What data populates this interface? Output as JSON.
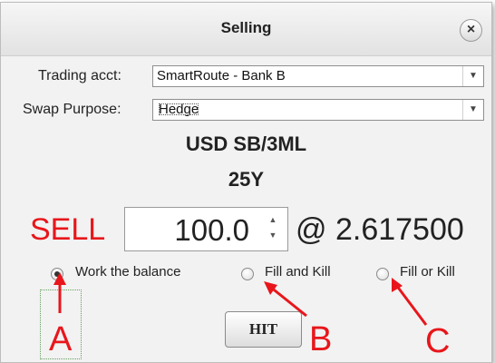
{
  "dialog": {
    "title": "Selling",
    "close_icon": "×"
  },
  "form": {
    "trading_acct_label": "Trading acct:",
    "trading_acct_value": "SmartRoute - Bank B",
    "swap_purpose_label": "Swap Purpose:",
    "swap_purpose_value": "Hedge",
    "dropdown_arrow": "▼"
  },
  "instrument": {
    "name": "USD SB/3ML",
    "tenor": "25Y"
  },
  "order": {
    "side": "SELL",
    "quantity": "100.0",
    "price": "@ 2.617500",
    "spin_up": "▲",
    "spin_down": "▼"
  },
  "options": [
    {
      "label": "Work the balance",
      "selected": true
    },
    {
      "label": "Fill and Kill",
      "selected": false
    },
    {
      "label": "Fill or Kill",
      "selected": false
    }
  ],
  "action": {
    "hit_label": "HIT"
  },
  "annotations": {
    "letters": [
      "A",
      "B",
      "C"
    ],
    "color": "#e8161b"
  }
}
